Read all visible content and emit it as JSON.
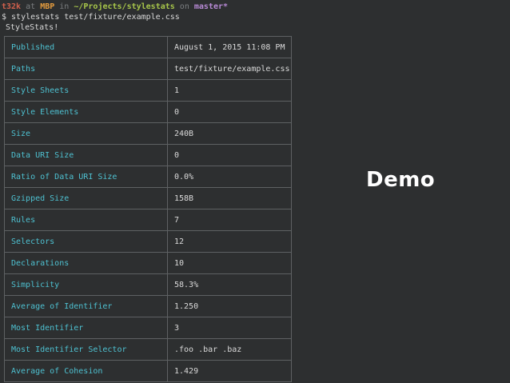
{
  "prompt": {
    "user": "t32k",
    "at": " at ",
    "host": "MBP",
    "in": " in ",
    "path": "~/Projects/stylestats",
    "on": " on ",
    "branch": "master*"
  },
  "command": "$ stylestats test/fixture/example.css",
  "banner": "StyleStats!",
  "stats": [
    {
      "key": "Published",
      "value": "August 1, 2015 11:08 PM"
    },
    {
      "key": "Paths",
      "value": "test/fixture/example.css"
    },
    {
      "key": "Style Sheets",
      "value": "1"
    },
    {
      "key": "Style Elements",
      "value": "0"
    },
    {
      "key": "Size",
      "value": "240B"
    },
    {
      "key": "Data URI Size",
      "value": "0"
    },
    {
      "key": "Ratio of Data URI Size",
      "value": "0.0%"
    },
    {
      "key": "Gzipped Size",
      "value": "158B"
    },
    {
      "key": "Rules",
      "value": "7"
    },
    {
      "key": "Selectors",
      "value": "12"
    },
    {
      "key": "Declarations",
      "value": "10"
    },
    {
      "key": "Simplicity",
      "value": "58.3%"
    },
    {
      "key": "Average of Identifier",
      "value": "1.250"
    },
    {
      "key": "Most Identifier",
      "value": "3"
    },
    {
      "key": "Most Identifier Selector",
      "value": ".foo .bar .baz"
    },
    {
      "key": "Average of Cohesion",
      "value": "1.429"
    }
  ],
  "slide_label": "Demo",
  "colors": {
    "background": "#2d2f30",
    "key_text": "#4ec1d1",
    "value_text": "#d9d9d9",
    "border": "#5e6163"
  }
}
